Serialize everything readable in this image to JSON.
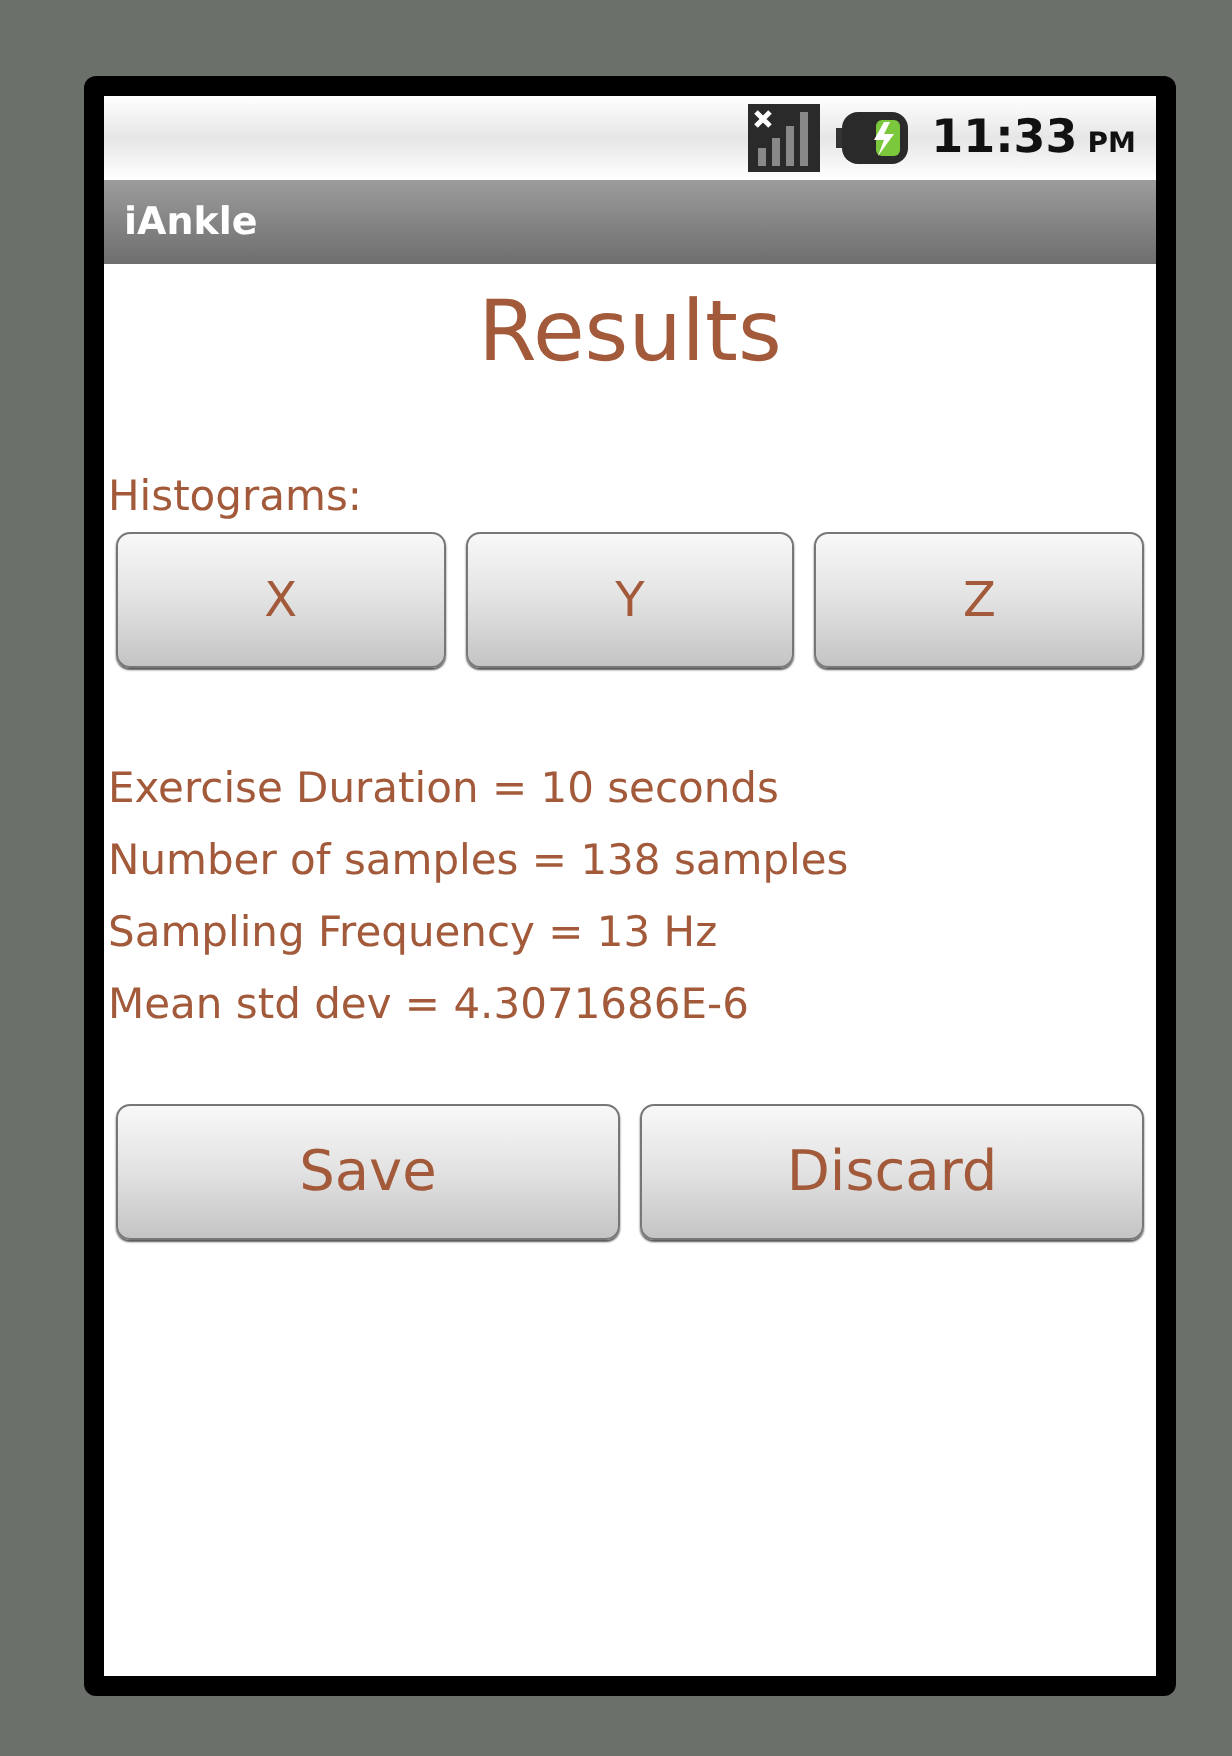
{
  "status_bar": {
    "time": "11:33",
    "meridiem": "PM"
  },
  "window": {
    "title": "iAnkle"
  },
  "heading": "Results",
  "histograms": {
    "label": "Histograms:",
    "buttons": [
      "X",
      "Y",
      "Z"
    ]
  },
  "stats": [
    "Exercise Duration = 10 seconds",
    "Number of samples = 138 samples",
    "Sampling Frequency = 13 Hz",
    "Mean std dev = 4.3071686E-6"
  ],
  "actions": [
    "Save",
    "Discard"
  ]
}
